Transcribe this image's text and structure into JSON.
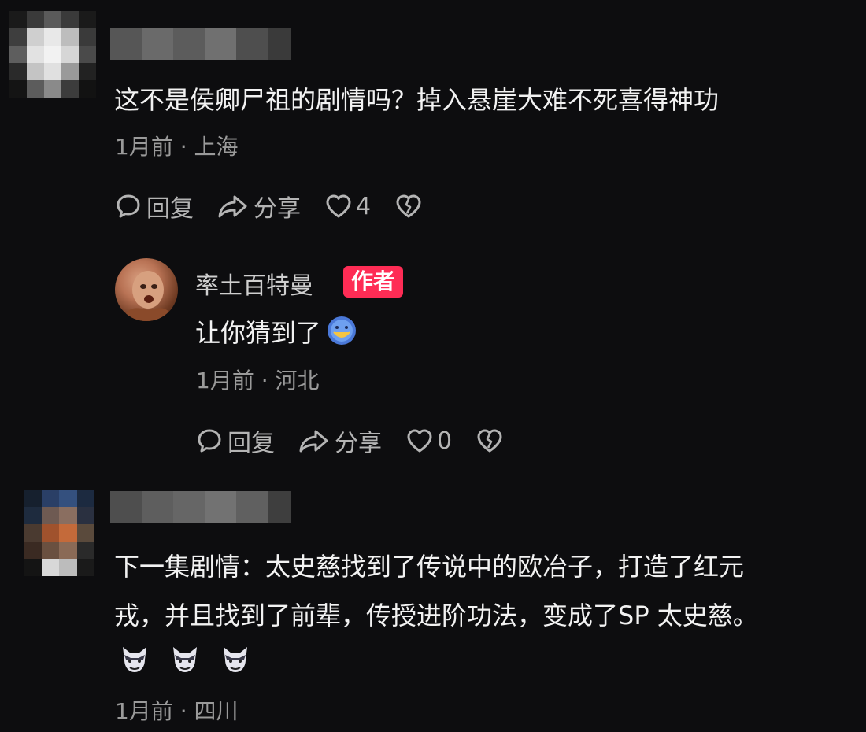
{
  "comments": [
    {
      "text": "这不是侯卿尸祖的剧情吗？掉入悬崖大难不死喜得神功",
      "meta": "1月前 · 上海",
      "reply_label": "回复",
      "share_label": "分享",
      "like_count": "4"
    },
    {
      "author": "率土百特曼",
      "badge": "作者",
      "text": "让你猜到了",
      "meta": "1月前 · 河北",
      "reply_label": "回复",
      "share_label": "分享",
      "like_count": "0"
    },
    {
      "text_lines": [
        "下一集剧情：太史慈找到了传说中的欧冶子，打造了红元",
        "戎，并且找到了前辈，传授进阶功法，变成了SP 太史慈。"
      ],
      "meta": "1月前 · 四川"
    }
  ],
  "icons": {
    "reply": "reply-bubble-icon",
    "share": "share-arrow-icon",
    "like": "heart-icon",
    "dislike": "broken-heart-icon",
    "emoji": "smile-emoji-icon",
    "sticker": "wolf-sticker-icon"
  },
  "colors": {
    "background": "#0d0d0f",
    "badge": "#fe2c55",
    "meta": "#9a9a9a",
    "text": "#f2f2f2"
  }
}
